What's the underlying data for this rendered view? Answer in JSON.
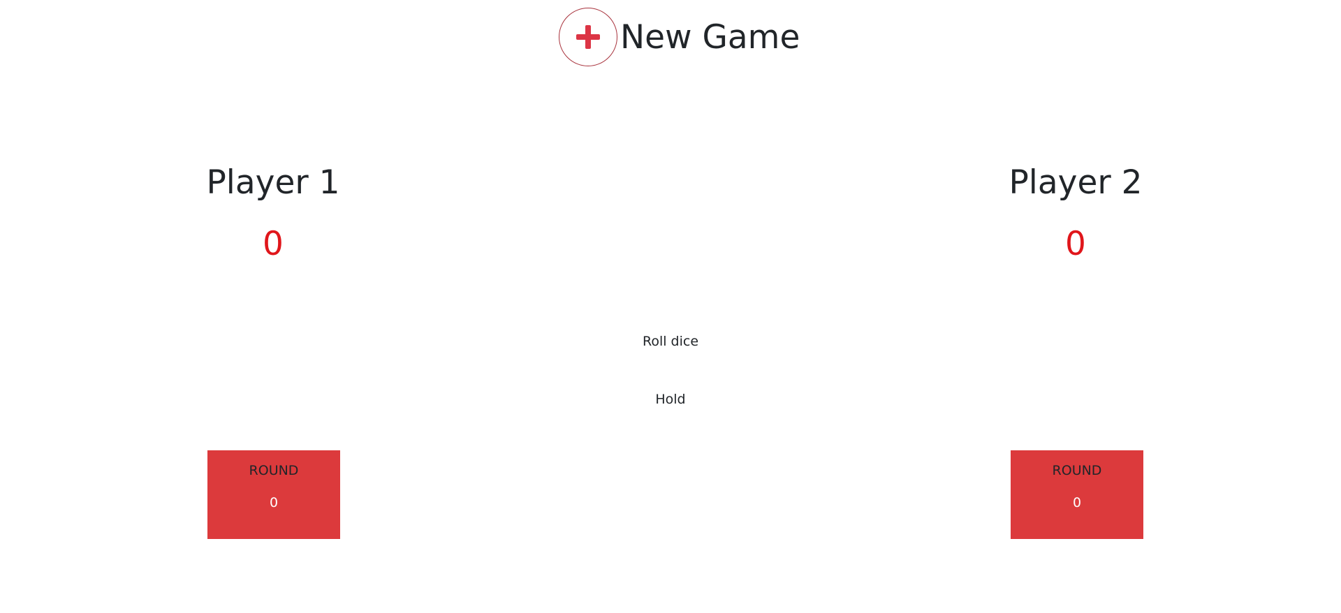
{
  "header": {
    "new_game_label": "New Game",
    "new_game_icon": "plus-icon"
  },
  "players": [
    {
      "name": "Player 1",
      "score": "0",
      "round_label": "ROUND",
      "round_score": "0"
    },
    {
      "name": "Player 2",
      "score": "0",
      "round_label": "ROUND",
      "round_score": "0"
    }
  ],
  "controls": {
    "roll_label": "Roll dice",
    "hold_label": "Hold"
  },
  "colors": {
    "accent": "#dc3a3c",
    "score_text": "#e0161b",
    "round_value_text": "#ffffff"
  }
}
